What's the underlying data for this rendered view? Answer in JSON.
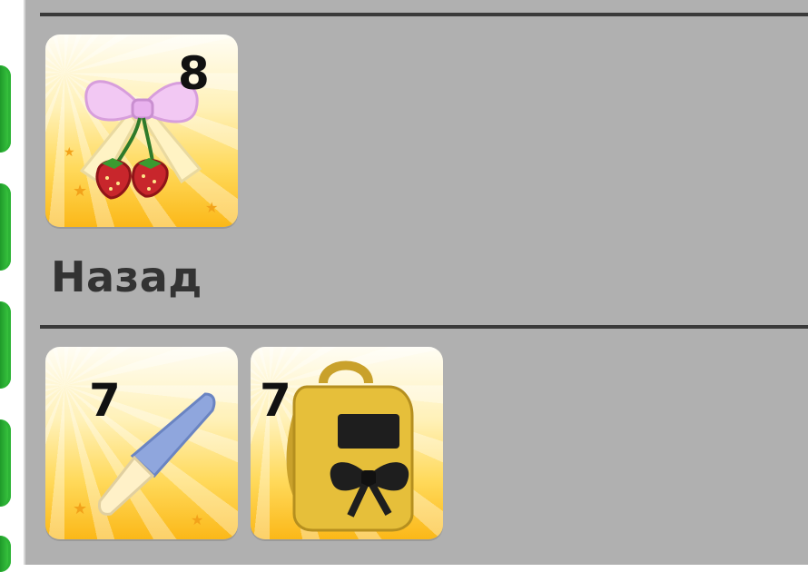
{
  "sections": [
    {
      "items": [
        {
          "icon": "bow-strawberry-icon",
          "count": "8"
        }
      ]
    },
    {
      "title": "Назад",
      "items": [
        {
          "icon": "knife-icon",
          "count": "7"
        },
        {
          "icon": "bow-backpack-icon",
          "count": "7"
        }
      ]
    }
  ],
  "colors": {
    "panel": "#b0b0b0",
    "tile_top": "#fffdf4",
    "tile_bottom": "#fbb818",
    "tab": "#2fbf36"
  }
}
